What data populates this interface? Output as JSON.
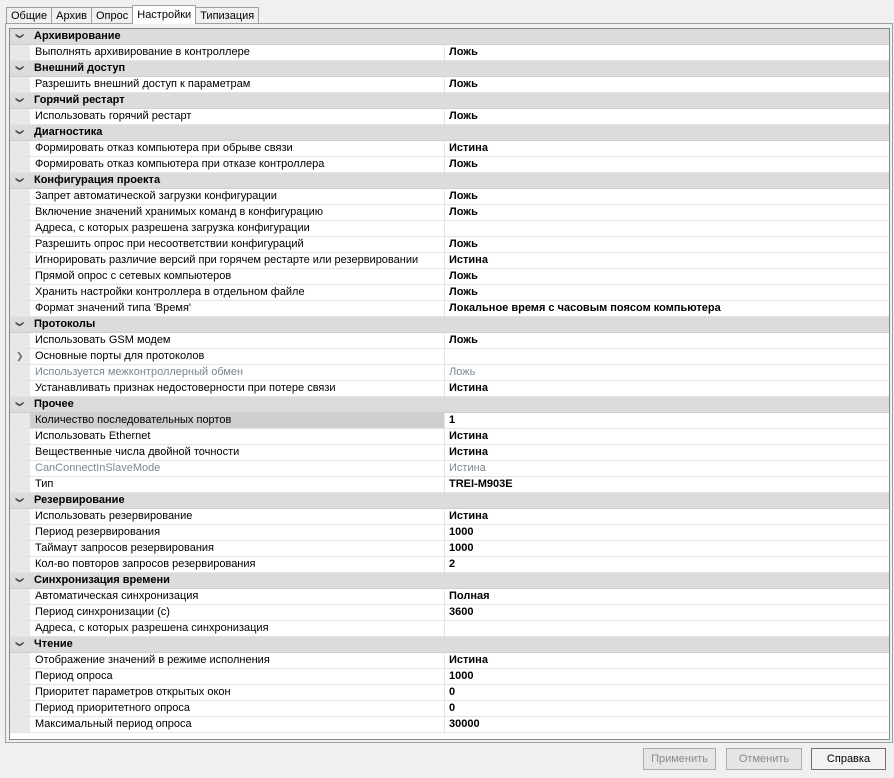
{
  "tabs": [
    {
      "label": "Общие",
      "active": false
    },
    {
      "label": "Архив",
      "active": false
    },
    {
      "label": "Опрос",
      "active": false
    },
    {
      "label": "Настройки",
      "active": true
    },
    {
      "label": "Типизация",
      "active": false
    }
  ],
  "categories": [
    {
      "title": "Архивирование",
      "rows": [
        {
          "name": "Выполнять архивирование в контроллере",
          "value": "Ложь"
        }
      ]
    },
    {
      "title": "Внешний доступ",
      "rows": [
        {
          "name": "Разрешить внешний доступ к параметрам",
          "value": "Ложь"
        }
      ]
    },
    {
      "title": "Горячий рестарт",
      "rows": [
        {
          "name": "Использовать горячий рестарт",
          "value": "Ложь"
        }
      ]
    },
    {
      "title": "Диагностика",
      "rows": [
        {
          "name": "Формировать отказ компьютера при обрыве связи",
          "value": "Истина"
        },
        {
          "name": "Формировать отказ компьютера при отказе контроллера",
          "value": "Ложь"
        }
      ]
    },
    {
      "title": "Конфигурация проекта",
      "rows": [
        {
          "name": "Запрет автоматической загрузки конфигурации",
          "value": "Ложь"
        },
        {
          "name": "Включение значений хранимых команд в конфигурацию",
          "value": "Ложь"
        },
        {
          "name": "Адреса, с которых разрешена загрузка конфигурации",
          "value": ""
        },
        {
          "name": "Разрешить опрос при несоответствии конфигураций",
          "value": "Ложь"
        },
        {
          "name": "Игнорировать различие версий при горячем рестарте или резервировании",
          "value": "Истина"
        },
        {
          "name": "Прямой опрос с сетевых компьютеров",
          "value": "Ложь"
        },
        {
          "name": "Хранить настройки контроллера в отдельном файле",
          "value": "Ложь"
        },
        {
          "name": "Формат значений типа 'Время'",
          "value": "Локальное время с часовым поясом компьютера"
        }
      ]
    },
    {
      "title": "Протоколы",
      "rows": [
        {
          "name": "Использовать GSM модем",
          "value": "Ложь"
        },
        {
          "name": "Основные порты для протоколов",
          "value": "",
          "expandable": true
        },
        {
          "name": "Используется межконтроллерный обмен",
          "value": "Ложь",
          "disabled": true
        },
        {
          "name": "Устанавливать признак недостоверности при потере связи",
          "value": "Истина"
        }
      ]
    },
    {
      "title": "Прочее",
      "rows": [
        {
          "name": "Количество последовательных портов",
          "value": "1",
          "selected": true
        },
        {
          "name": "Использовать Ethernet",
          "value": "Истина"
        },
        {
          "name": "Вещественные числа двойной точности",
          "value": "Истина"
        },
        {
          "name": "CanConnectInSlaveMode",
          "value": "Истина",
          "disabled": true
        },
        {
          "name": "Тип",
          "value": "TREI-M903E"
        }
      ]
    },
    {
      "title": "Резервирование",
      "rows": [
        {
          "name": "Использовать резервирование",
          "value": "Истина"
        },
        {
          "name": "Период резервирования",
          "value": "1000"
        },
        {
          "name": "Таймаут запросов резервирования",
          "value": "1000"
        },
        {
          "name": "Кол-во повторов запросов резервирования",
          "value": "2"
        }
      ]
    },
    {
      "title": "Синхронизация времени",
      "rows": [
        {
          "name": "Автоматическая синхронизация",
          "value": "Полная"
        },
        {
          "name": "Период синхронизации (с)",
          "value": "3600"
        },
        {
          "name": "Адреса, с которых разрешена синхронизация",
          "value": ""
        }
      ]
    },
    {
      "title": "Чтение",
      "rows": [
        {
          "name": "Отображение значений в режиме исполнения",
          "value": "Истина"
        },
        {
          "name": "Период опроса",
          "value": "1000"
        },
        {
          "name": "Приоритет параметров открытых окон",
          "value": "0"
        },
        {
          "name": "Период приоритетного опроса",
          "value": "0"
        },
        {
          "name": "Максимальный период опроса",
          "value": "30000"
        }
      ]
    }
  ],
  "buttons": {
    "apply": "Применить",
    "cancel": "Отменить",
    "help": "Справка"
  }
}
